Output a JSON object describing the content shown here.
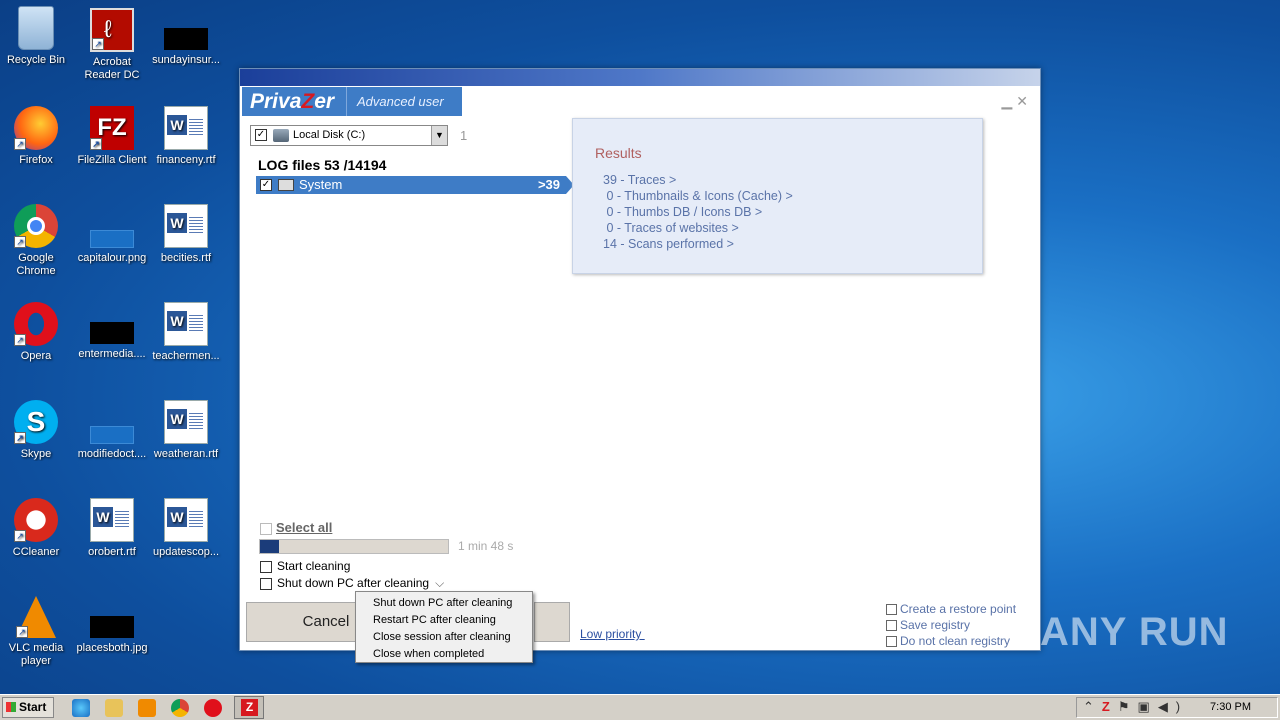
{
  "desktop": {
    "icons": [
      {
        "label": "Recycle Bin"
      },
      {
        "label": "Acrobat Reader DC"
      },
      {
        "label": "sundayinsur..."
      },
      {
        "label": "Firefox"
      },
      {
        "label": "FileZilla Client"
      },
      {
        "label": "financeny.rtf"
      },
      {
        "label": "Google Chrome"
      },
      {
        "label": "capitalour.png"
      },
      {
        "label": "becities.rtf"
      },
      {
        "label": "Opera"
      },
      {
        "label": "entermedia...."
      },
      {
        "label": "teachermen..."
      },
      {
        "label": "Skype"
      },
      {
        "label": "modifiedoct...."
      },
      {
        "label": "weatheran.rtf"
      },
      {
        "label": "CCleaner"
      },
      {
        "label": "orobert.rtf"
      },
      {
        "label": "updatescop..."
      },
      {
        "label": "VLC media player"
      },
      {
        "label": "placesboth.jpg"
      }
    ]
  },
  "window": {
    "brand": {
      "prefix": "Priva",
      "z": "Z",
      "suffix": "er",
      "mode": "Advanced user"
    },
    "disk": {
      "label": "Local Disk (C:)",
      "index": "1"
    },
    "log_title": "LOG files 53 /14194",
    "system_row": {
      "label": "System",
      "count": ">39"
    },
    "results": {
      "title": "Results",
      "items": [
        "39 - Traces >",
        " 0 - Thumbnails & Icons (Cache) >",
        " 0 - Thumbs DB / Icons DB >",
        " 0 - Traces of websites >",
        "14 - Scans performed >"
      ]
    },
    "select_all": "Select all",
    "progress": {
      "fraction": 0.1
    },
    "time_left": "1 min 48 s",
    "start_cleaning": "Start cleaning",
    "after_cleaning": "Shut down PC after cleaning",
    "cancel": "Cancel",
    "low_priority": "Low priority ",
    "registry": {
      "restore_point": "Create a restore point",
      "save_registry": "Save registry",
      "do_not_clean": "Do not clean registry"
    },
    "dropdown": [
      "Shut down PC after cleaning",
      "Restart PC after cleaning",
      "Close session after cleaning",
      "Close when completed"
    ]
  },
  "watermark": "ANY RUN",
  "taskbar": {
    "start": "Start",
    "clock": "7:30 PM"
  }
}
